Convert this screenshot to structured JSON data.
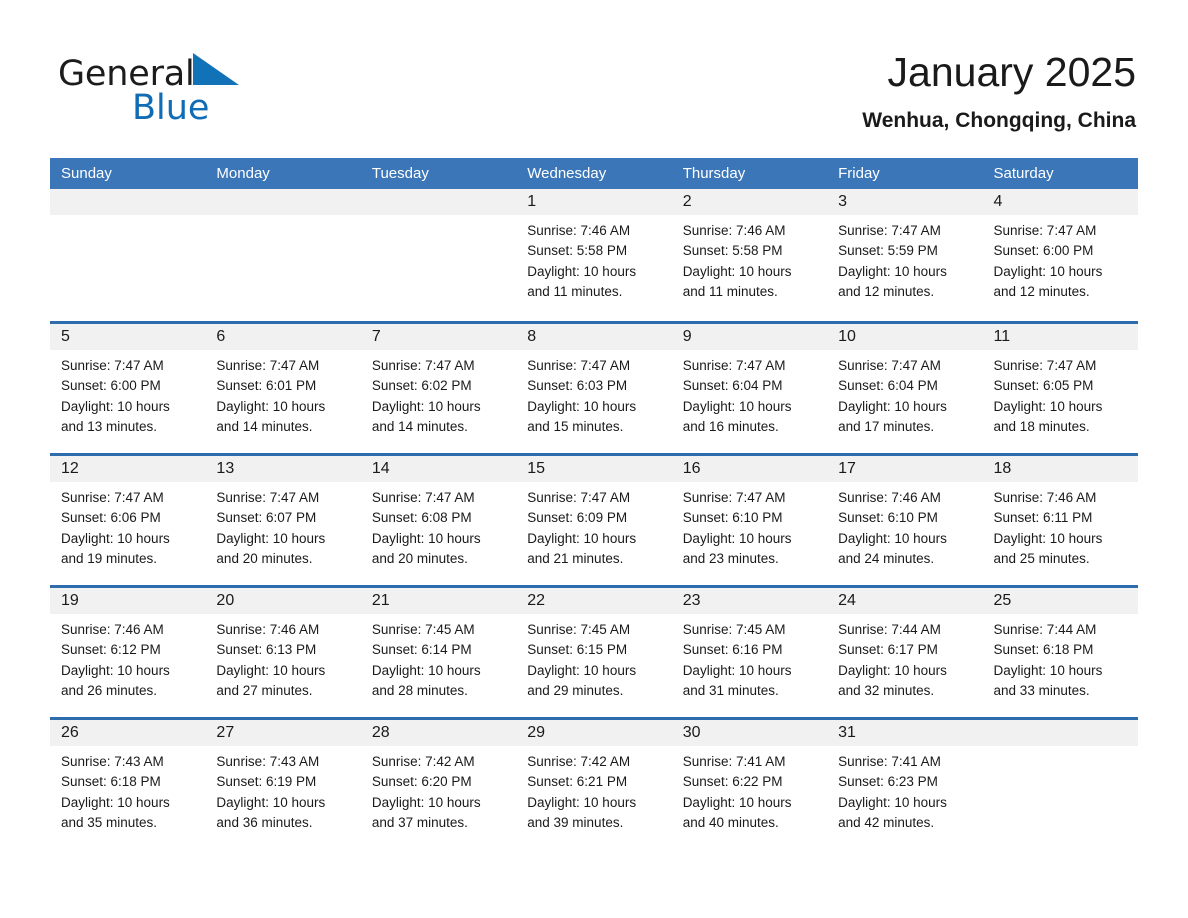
{
  "brand": {
    "name_part1": "General",
    "name_part2": "Blue",
    "triangle_color": "#1272b8",
    "blue_color": "#0f6cb5"
  },
  "header": {
    "title": "January 2025",
    "location": "Wenhua, Chongqing, China",
    "header_bg": "#3a76b8",
    "row_divider_color": "#2d6cad",
    "daynum_bg": "#f1f1f1"
  },
  "weekdays": [
    "Sunday",
    "Monday",
    "Tuesday",
    "Wednesday",
    "Thursday",
    "Friday",
    "Saturday"
  ],
  "weeks": [
    [
      {
        "day": "",
        "detail": ""
      },
      {
        "day": "",
        "detail": ""
      },
      {
        "day": "",
        "detail": ""
      },
      {
        "day": "1",
        "detail": "Sunrise: 7:46 AM\nSunset: 5:58 PM\nDaylight: 10 hours\nand 11 minutes."
      },
      {
        "day": "2",
        "detail": "Sunrise: 7:46 AM\nSunset: 5:58 PM\nDaylight: 10 hours\nand 11 minutes."
      },
      {
        "day": "3",
        "detail": "Sunrise: 7:47 AM\nSunset: 5:59 PM\nDaylight: 10 hours\nand 12 minutes."
      },
      {
        "day": "4",
        "detail": "Sunrise: 7:47 AM\nSunset: 6:00 PM\nDaylight: 10 hours\nand 12 minutes."
      }
    ],
    [
      {
        "day": "5",
        "detail": "Sunrise: 7:47 AM\nSunset: 6:00 PM\nDaylight: 10 hours\nand 13 minutes."
      },
      {
        "day": "6",
        "detail": "Sunrise: 7:47 AM\nSunset: 6:01 PM\nDaylight: 10 hours\nand 14 minutes."
      },
      {
        "day": "7",
        "detail": "Sunrise: 7:47 AM\nSunset: 6:02 PM\nDaylight: 10 hours\nand 14 minutes."
      },
      {
        "day": "8",
        "detail": "Sunrise: 7:47 AM\nSunset: 6:03 PM\nDaylight: 10 hours\nand 15 minutes."
      },
      {
        "day": "9",
        "detail": "Sunrise: 7:47 AM\nSunset: 6:04 PM\nDaylight: 10 hours\nand 16 minutes."
      },
      {
        "day": "10",
        "detail": "Sunrise: 7:47 AM\nSunset: 6:04 PM\nDaylight: 10 hours\nand 17 minutes."
      },
      {
        "day": "11",
        "detail": "Sunrise: 7:47 AM\nSunset: 6:05 PM\nDaylight: 10 hours\nand 18 minutes."
      }
    ],
    [
      {
        "day": "12",
        "detail": "Sunrise: 7:47 AM\nSunset: 6:06 PM\nDaylight: 10 hours\nand 19 minutes."
      },
      {
        "day": "13",
        "detail": "Sunrise: 7:47 AM\nSunset: 6:07 PM\nDaylight: 10 hours\nand 20 minutes."
      },
      {
        "day": "14",
        "detail": "Sunrise: 7:47 AM\nSunset: 6:08 PM\nDaylight: 10 hours\nand 20 minutes."
      },
      {
        "day": "15",
        "detail": "Sunrise: 7:47 AM\nSunset: 6:09 PM\nDaylight: 10 hours\nand 21 minutes."
      },
      {
        "day": "16",
        "detail": "Sunrise: 7:47 AM\nSunset: 6:10 PM\nDaylight: 10 hours\nand 23 minutes."
      },
      {
        "day": "17",
        "detail": "Sunrise: 7:46 AM\nSunset: 6:10 PM\nDaylight: 10 hours\nand 24 minutes."
      },
      {
        "day": "18",
        "detail": "Sunrise: 7:46 AM\nSunset: 6:11 PM\nDaylight: 10 hours\nand 25 minutes."
      }
    ],
    [
      {
        "day": "19",
        "detail": "Sunrise: 7:46 AM\nSunset: 6:12 PM\nDaylight: 10 hours\nand 26 minutes."
      },
      {
        "day": "20",
        "detail": "Sunrise: 7:46 AM\nSunset: 6:13 PM\nDaylight: 10 hours\nand 27 minutes."
      },
      {
        "day": "21",
        "detail": "Sunrise: 7:45 AM\nSunset: 6:14 PM\nDaylight: 10 hours\nand 28 minutes."
      },
      {
        "day": "22",
        "detail": "Sunrise: 7:45 AM\nSunset: 6:15 PM\nDaylight: 10 hours\nand 29 minutes."
      },
      {
        "day": "23",
        "detail": "Sunrise: 7:45 AM\nSunset: 6:16 PM\nDaylight: 10 hours\nand 31 minutes."
      },
      {
        "day": "24",
        "detail": "Sunrise: 7:44 AM\nSunset: 6:17 PM\nDaylight: 10 hours\nand 32 minutes."
      },
      {
        "day": "25",
        "detail": "Sunrise: 7:44 AM\nSunset: 6:18 PM\nDaylight: 10 hours\nand 33 minutes."
      }
    ],
    [
      {
        "day": "26",
        "detail": "Sunrise: 7:43 AM\nSunset: 6:18 PM\nDaylight: 10 hours\nand 35 minutes."
      },
      {
        "day": "27",
        "detail": "Sunrise: 7:43 AM\nSunset: 6:19 PM\nDaylight: 10 hours\nand 36 minutes."
      },
      {
        "day": "28",
        "detail": "Sunrise: 7:42 AM\nSunset: 6:20 PM\nDaylight: 10 hours\nand 37 minutes."
      },
      {
        "day": "29",
        "detail": "Sunrise: 7:42 AM\nSunset: 6:21 PM\nDaylight: 10 hours\nand 39 minutes."
      },
      {
        "day": "30",
        "detail": "Sunrise: 7:41 AM\nSunset: 6:22 PM\nDaylight: 10 hours\nand 40 minutes."
      },
      {
        "day": "31",
        "detail": "Sunrise: 7:41 AM\nSunset: 6:23 PM\nDaylight: 10 hours\nand 42 minutes."
      },
      {
        "day": "",
        "detail": ""
      }
    ]
  ]
}
